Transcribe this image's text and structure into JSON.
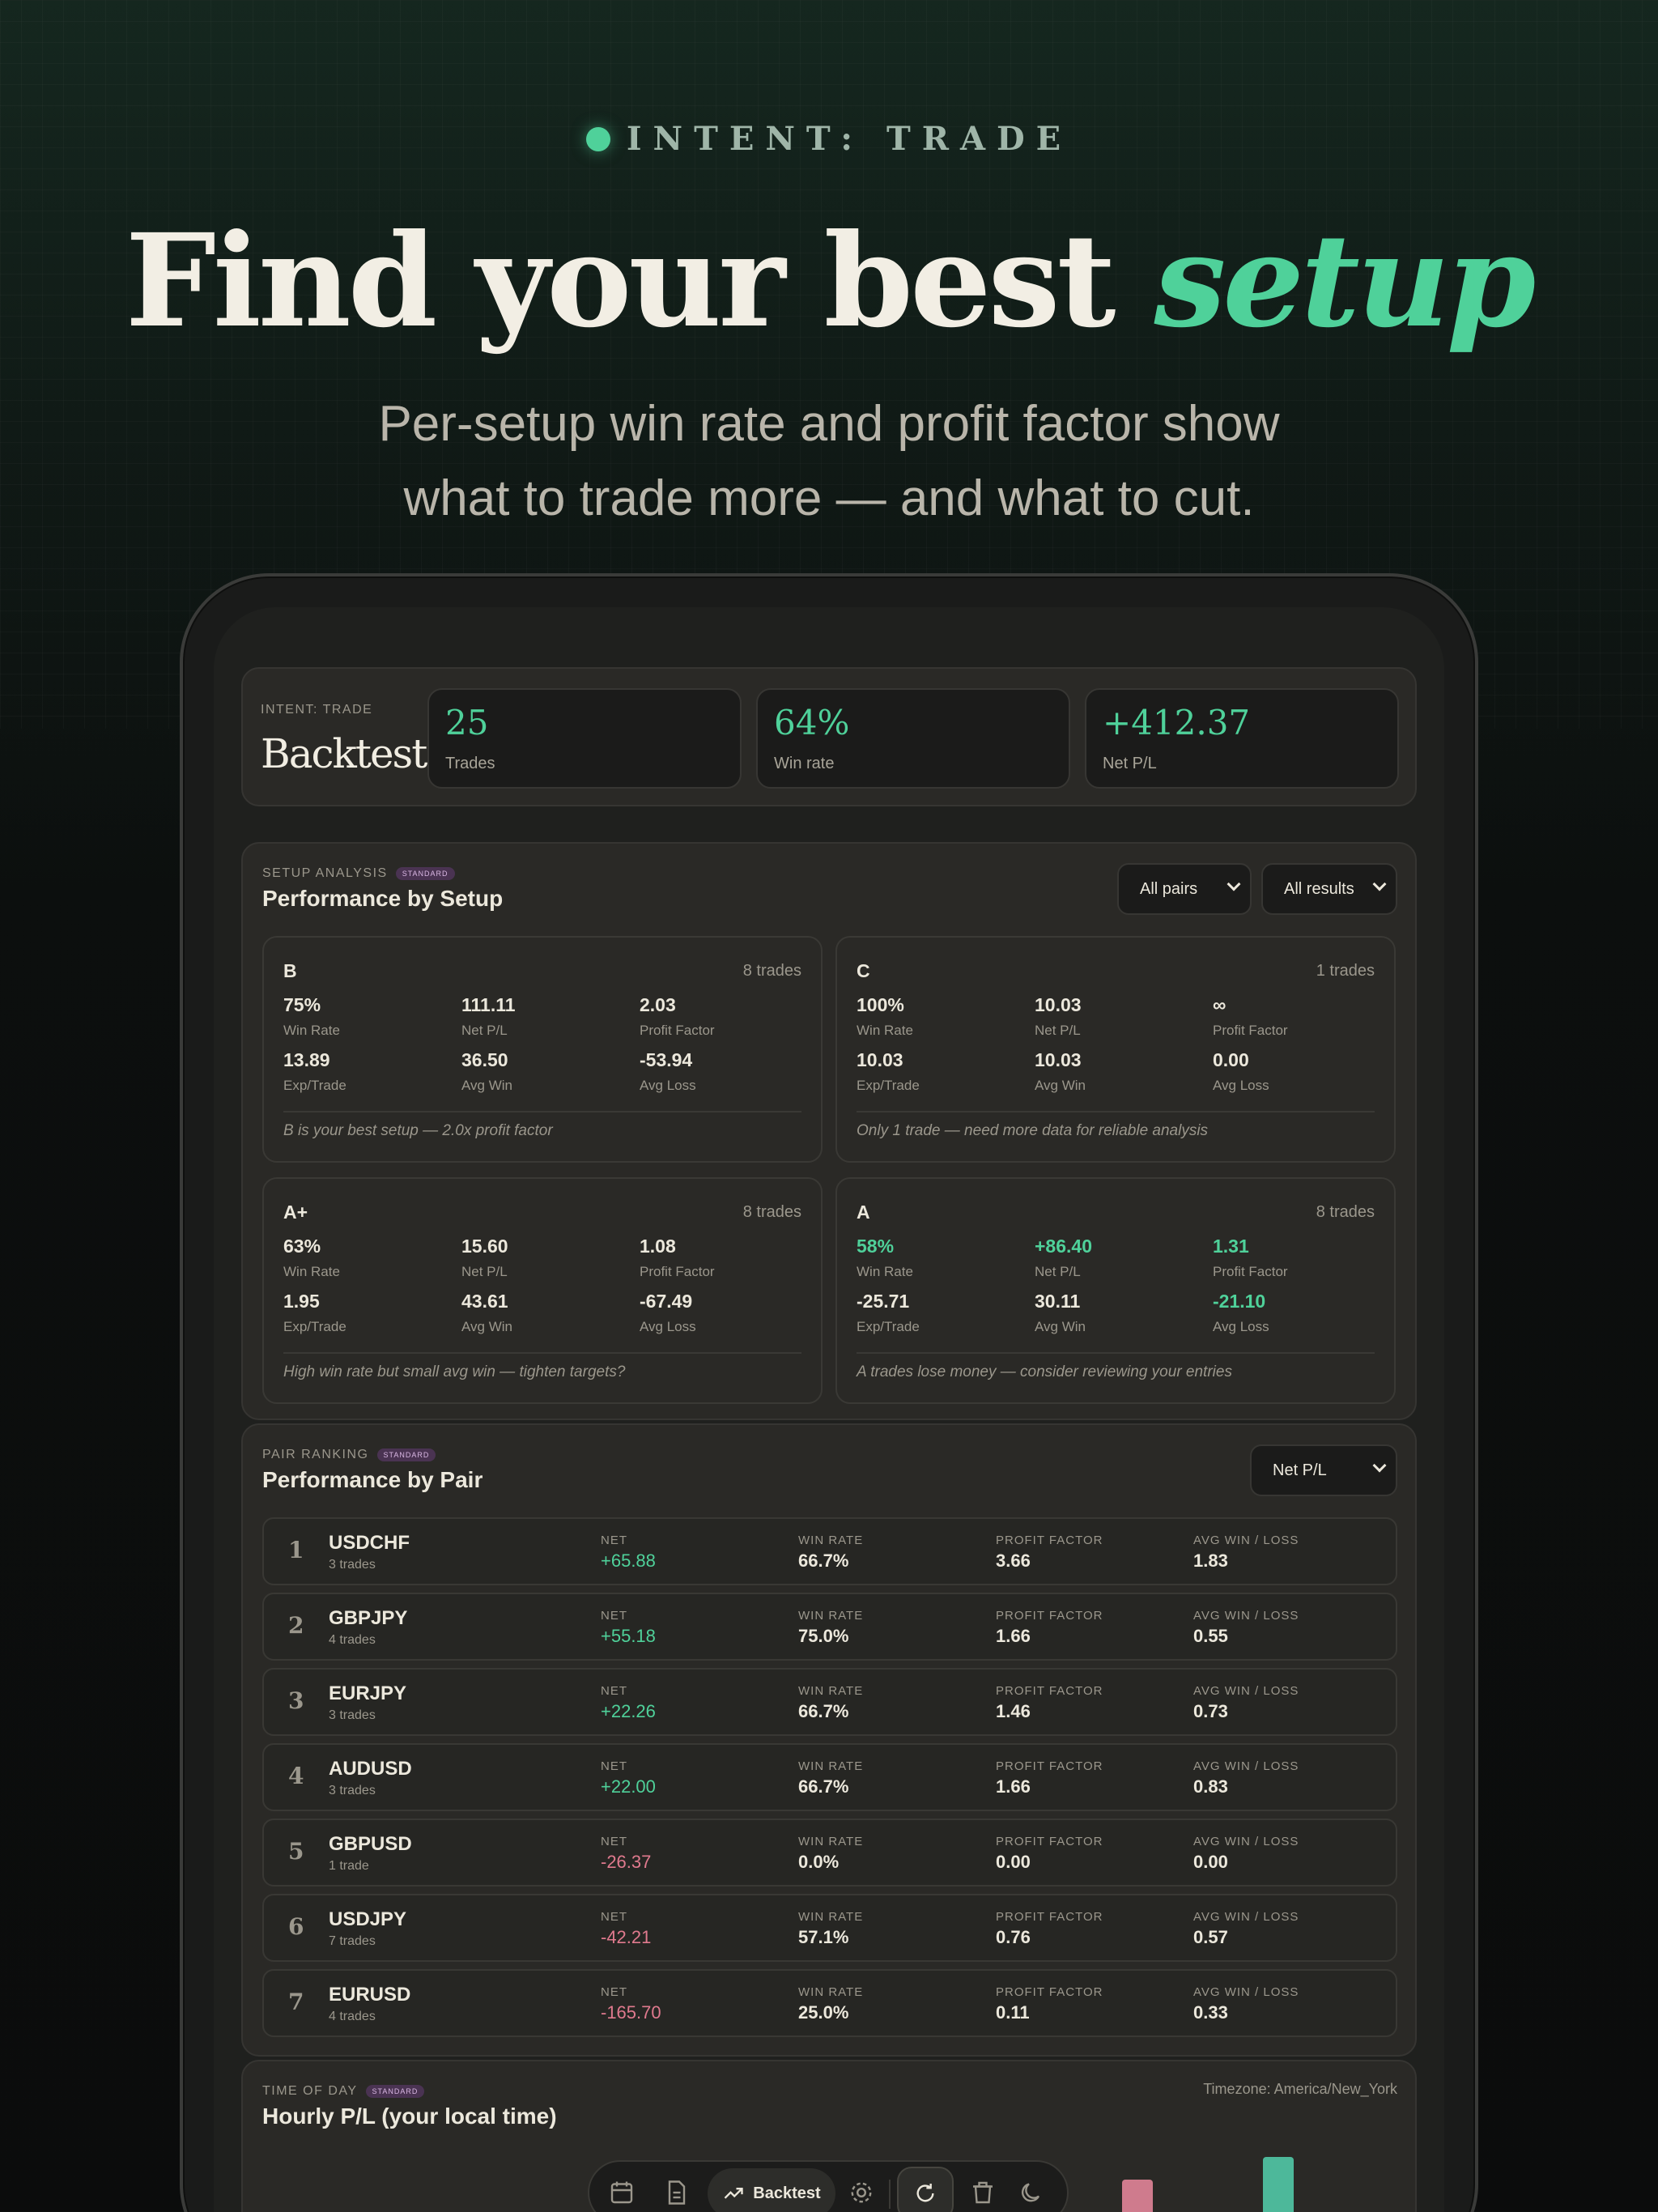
{
  "hero": {
    "eyebrow": "INTENT: TRADE",
    "title_main": "Find your best ",
    "title_accent": "setup",
    "subtitle_line1": "Per-setup win rate and profit factor show",
    "subtitle_line2": "what to trade more — and what to cut."
  },
  "header": {
    "eyebrow": "INTENT: TRADE",
    "title": "Backtest",
    "stats": [
      {
        "value": "25",
        "label": "Trades"
      },
      {
        "value": "64%",
        "label": "Win rate"
      },
      {
        "value": "+412.37",
        "label": "Net P/L"
      }
    ]
  },
  "setup_analysis": {
    "eyebrow": "SETUP ANALYSIS",
    "badge": "STANDARD",
    "title": "Performance by Setup",
    "filter_pairs": "All pairs",
    "filter_results": "All results",
    "setups": [
      {
        "name": "B",
        "count": "8 trades",
        "win_rate": "75%",
        "net_pl": "111.11",
        "profit_factor": "2.03",
        "exp_trade": "13.89",
        "avg_win": "36.50",
        "avg_loss": "-53.94",
        "note": "B is your best setup — 2.0x profit factor"
      },
      {
        "name": "C",
        "count": "1 trades",
        "win_rate": "100%",
        "net_pl": "10.03",
        "profit_factor": "∞",
        "exp_trade": "10.03",
        "avg_win": "10.03",
        "avg_loss": "0.00",
        "note": "Only 1 trade — need more data for reliable analysis"
      },
      {
        "name": "A+",
        "count": "8 trades",
        "win_rate": "63%",
        "net_pl": "15.60",
        "profit_factor": "1.08",
        "exp_trade": "1.95",
        "avg_win": "43.61",
        "avg_loss": "-67.49",
        "note": "High win rate but small avg win — tighten targets?"
      },
      {
        "name": "A",
        "count": "8 trades",
        "win_rate": "58%",
        "net_pl": "+86.40",
        "profit_factor": "1.31",
        "exp_trade": "-25.71",
        "avg_win": "30.11",
        "avg_loss": "-21.10",
        "note": "A trades lose money — consider reviewing your entries"
      }
    ],
    "labels": {
      "win_rate": "Win Rate",
      "net_pl": "Net P/L",
      "profit_factor": "Profit Factor",
      "exp_trade": "Exp/Trade",
      "avg_win": "Avg Win",
      "avg_loss": "Avg Loss"
    }
  },
  "pair_ranking": {
    "eyebrow": "PAIR RANKING",
    "badge": "STANDARD",
    "title": "Performance by Pair",
    "sort": "Net P/L",
    "labels": {
      "net": "NET",
      "win_rate": "WIN RATE",
      "profit_factor": "PROFIT FACTOR",
      "avg_win_loss": "AVG WIN / LOSS"
    },
    "pairs": [
      {
        "rank": "1",
        "name": "USDCHF",
        "trades": "3 trades",
        "net": "+65.88",
        "win_rate": "66.7%",
        "profit_factor": "3.66",
        "avg_win_loss": "1.83"
      },
      {
        "rank": "2",
        "name": "GBPJPY",
        "trades": "4 trades",
        "net": "+55.18",
        "win_rate": "75.0%",
        "profit_factor": "1.66",
        "avg_win_loss": "0.55"
      },
      {
        "rank": "3",
        "name": "EURJPY",
        "trades": "3 trades",
        "net": "+22.26",
        "win_rate": "66.7%",
        "profit_factor": "1.46",
        "avg_win_loss": "0.73"
      },
      {
        "rank": "4",
        "name": "AUDUSD",
        "trades": "3 trades",
        "net": "+22.00",
        "win_rate": "66.7%",
        "profit_factor": "1.66",
        "avg_win_loss": "0.83"
      },
      {
        "rank": "5",
        "name": "GBPUSD",
        "trades": "1 trade",
        "net": "-26.37",
        "win_rate": "0.0%",
        "profit_factor": "0.00",
        "avg_win_loss": "0.00"
      },
      {
        "rank": "6",
        "name": "USDJPY",
        "trades": "7 trades",
        "net": "-42.21",
        "win_rate": "57.1%",
        "profit_factor": "0.76",
        "avg_win_loss": "0.57"
      },
      {
        "rank": "7",
        "name": "EURUSD",
        "trades": "4 trades",
        "net": "-165.70",
        "win_rate": "25.0%",
        "profit_factor": "0.11",
        "avg_win_loss": "0.33"
      }
    ]
  },
  "time_of_day": {
    "eyebrow": "TIME OF DAY",
    "badge": "STANDARD",
    "title": "Hourly P/L (your local time)",
    "timezone": "Timezone: America/New_York"
  },
  "toolbar": {
    "active_label": "Backtest",
    "icons": [
      "calendar-icon",
      "document-icon",
      "trend-icon",
      "gear-icon",
      "refresh-icon",
      "trash-icon",
      "moon-icon"
    ]
  },
  "colors": {
    "accent": "#4fd19a",
    "negative": "#e07a8e",
    "badge": "#4a3352"
  }
}
